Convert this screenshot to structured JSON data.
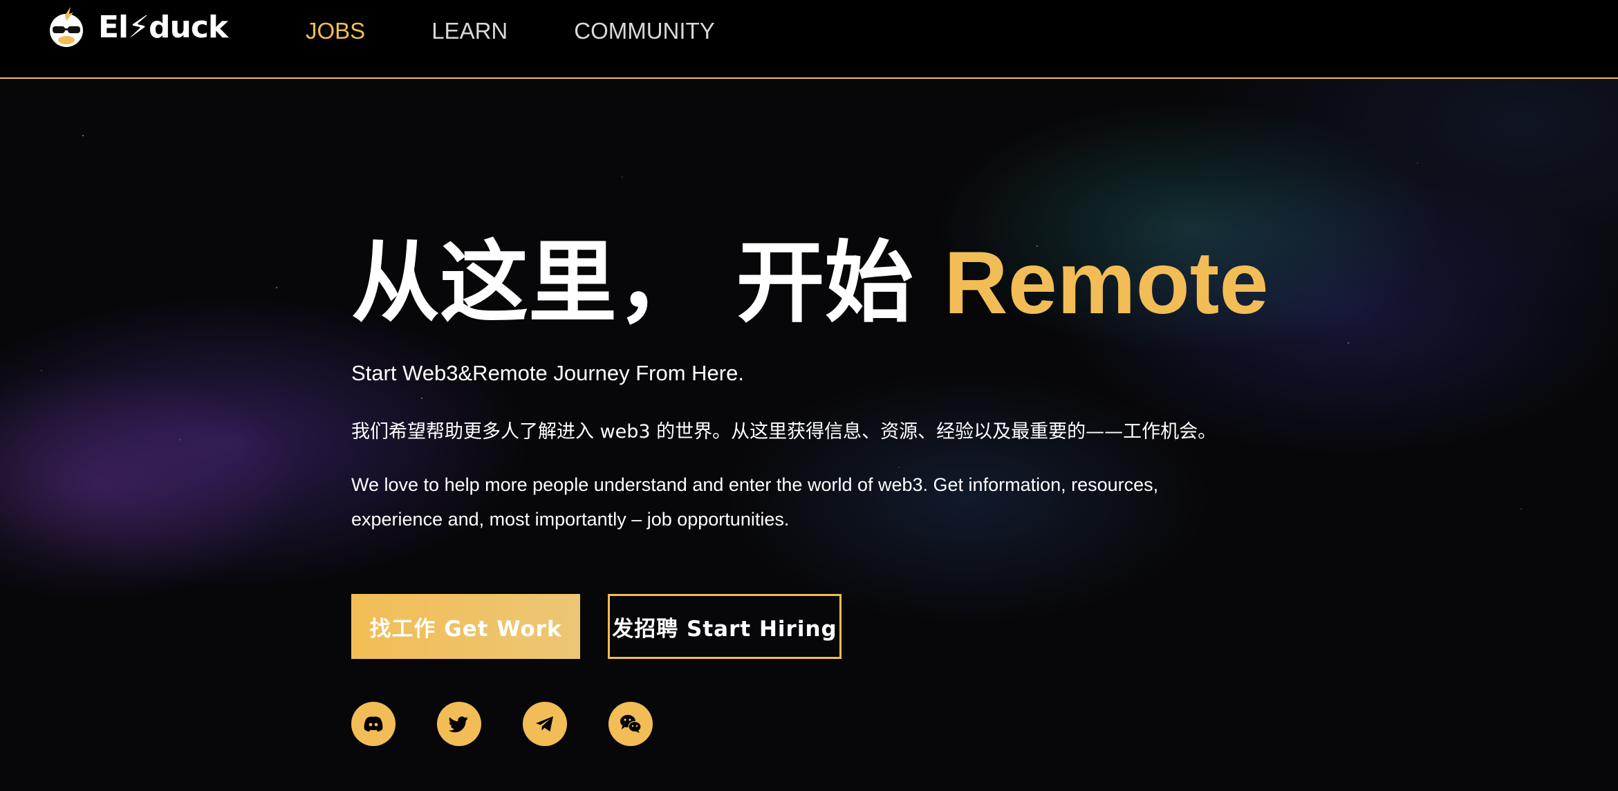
{
  "brand": {
    "name": "El⚡duck",
    "accent_color": "#f2bd56"
  },
  "nav": {
    "items": [
      {
        "label": "JOBS",
        "active": true
      },
      {
        "label": "LEARN",
        "active": false
      },
      {
        "label": "COMMUNITY",
        "active": false
      }
    ]
  },
  "hero": {
    "title_main": "从这里， 开始 ",
    "title_accent": "Remote",
    "subtitle": "Start Web3&Remote Journey From Here.",
    "description_cn": "我们希望帮助更多人了解进入 web3 的世界。从这里获得信息、资源、经验以及最重要的——工作机会。",
    "description_en": "We love to help more people understand and enter the world of web3. Get information, resources, experience and, most importantly – job opportunities."
  },
  "buttons": {
    "get_work": "找工作 Get Work",
    "start_hiring": "发招聘 Start Hiring"
  },
  "socials": [
    {
      "icon": "discord-icon"
    },
    {
      "icon": "twitter-icon"
    },
    {
      "icon": "telegram-icon"
    },
    {
      "icon": "wechat-icon"
    }
  ]
}
